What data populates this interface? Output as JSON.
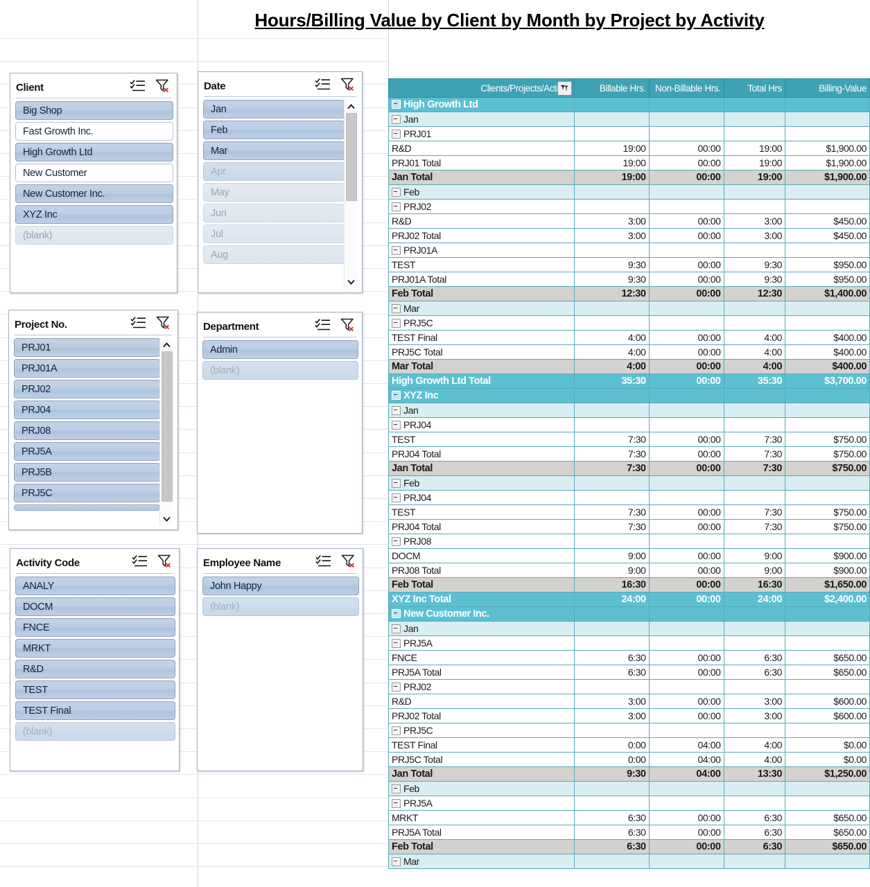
{
  "page": {
    "title": "Hours/Billing Value by Client by Month by Project by Activity"
  },
  "slicers": [
    {
      "name": "client",
      "title": "Client",
      "icons": {
        "multi_select": "multi-select-icon",
        "clear_filter": "clear-filter-icon"
      },
      "has_scrollbar": false,
      "items": [
        {
          "label": "Big Shop",
          "state": "selected"
        },
        {
          "label": "Fast Growth Inc.",
          "state": "unselected"
        },
        {
          "label": "High Growth Ltd",
          "state": "selected"
        },
        {
          "label": "New Customer",
          "state": "unselected"
        },
        {
          "label": "New Customer Inc.",
          "state": "selected"
        },
        {
          "label": "XYZ Inc",
          "state": "selected"
        },
        {
          "label": "(blank)",
          "state": "nodata"
        }
      ]
    },
    {
      "name": "date",
      "title": "Date",
      "icons": {
        "multi_select": "multi-select-icon",
        "clear_filter": "clear-filter-icon"
      },
      "has_scrollbar": true,
      "items": [
        {
          "label": "Jan",
          "state": "selected"
        },
        {
          "label": "Feb",
          "state": "selected"
        },
        {
          "label": "Mar",
          "state": "selected"
        },
        {
          "label": "Apr",
          "state": "nodata-selected"
        },
        {
          "label": "May",
          "state": "nodata"
        },
        {
          "label": "Jun",
          "state": "nodata"
        },
        {
          "label": "Jul",
          "state": "nodata"
        },
        {
          "label": "Aug",
          "state": "nodata"
        }
      ]
    },
    {
      "name": "project-no",
      "title": "Project No.",
      "icons": {
        "multi_select": "multi-select-icon",
        "clear_filter": "clear-filter-icon"
      },
      "has_scrollbar": true,
      "items": [
        {
          "label": "PRJ01",
          "state": "selected"
        },
        {
          "label": "PRJ01A",
          "state": "selected"
        },
        {
          "label": "PRJ02",
          "state": "selected"
        },
        {
          "label": "PRJ04",
          "state": "selected"
        },
        {
          "label": "PRJ08",
          "state": "selected"
        },
        {
          "label": "PRJ5A",
          "state": "selected"
        },
        {
          "label": "PRJ5B",
          "state": "selected"
        },
        {
          "label": "PRJ5C",
          "state": "selected"
        }
      ]
    },
    {
      "name": "department",
      "title": "Department",
      "icons": {
        "multi_select": "multi-select-icon",
        "clear_filter": "clear-filter-icon"
      },
      "has_scrollbar": false,
      "items": [
        {
          "label": "Admin",
          "state": "selected"
        },
        {
          "label": "(blank)",
          "state": "nodata-selected"
        }
      ]
    },
    {
      "name": "activity-code",
      "title": "Activity Code",
      "icons": {
        "multi_select": "multi-select-icon",
        "clear_filter": "clear-filter-icon"
      },
      "has_scrollbar": false,
      "items": [
        {
          "label": "ANALY",
          "state": "selected"
        },
        {
          "label": "DOCM",
          "state": "selected"
        },
        {
          "label": "FNCE",
          "state": "selected"
        },
        {
          "label": "MRKT",
          "state": "selected"
        },
        {
          "label": "R&D",
          "state": "selected"
        },
        {
          "label": "TEST",
          "state": "selected"
        },
        {
          "label": "TEST Final",
          "state": "selected"
        },
        {
          "label": "(blank)",
          "state": "nodata-selected"
        }
      ]
    },
    {
      "name": "employee-name",
      "title": "Employee Name",
      "icons": {
        "multi_select": "multi-select-icon",
        "clear_filter": "clear-filter-icon"
      },
      "has_scrollbar": false,
      "items": [
        {
          "label": "John Happy",
          "state": "selected"
        },
        {
          "label": "(blank)",
          "state": "nodata-selected"
        }
      ]
    }
  ],
  "pivot": {
    "columns": [
      "Clients/Projects/Activity",
      "Billable Hrs.",
      "Non-Billable Hrs.",
      "Total Hrs",
      "Billing-Value"
    ],
    "filter_icon": "filter-dropdown-icon",
    "rows": [
      {
        "level": "client",
        "label": "High Growth Ltd",
        "expand": true,
        "billable": "",
        "nonbillable": "",
        "total": "",
        "value": ""
      },
      {
        "level": "month",
        "label": "Jan",
        "expand": true,
        "billable": "",
        "nonbillable": "",
        "total": "",
        "value": ""
      },
      {
        "level": "project",
        "label": "PRJ01",
        "expand": true,
        "billable": "",
        "nonbillable": "",
        "total": "",
        "value": ""
      },
      {
        "level": "activity",
        "label": "R&D",
        "expand": false,
        "billable": "19:00",
        "nonbillable": "00:00",
        "total": "19:00",
        "value": "$1,900.00"
      },
      {
        "level": "projtotal",
        "label": "PRJ01 Total",
        "expand": false,
        "billable": "19:00",
        "nonbillable": "00:00",
        "total": "19:00",
        "value": "$1,900.00"
      },
      {
        "level": "monthtotal",
        "label": "Jan Total",
        "expand": false,
        "billable": "19:00",
        "nonbillable": "00:00",
        "total": "19:00",
        "value": "$1,900.00"
      },
      {
        "level": "month",
        "label": "Feb",
        "expand": true,
        "billable": "",
        "nonbillable": "",
        "total": "",
        "value": ""
      },
      {
        "level": "project",
        "label": "PRJ02",
        "expand": true,
        "billable": "",
        "nonbillable": "",
        "total": "",
        "value": ""
      },
      {
        "level": "activity",
        "label": "R&D",
        "expand": false,
        "billable": "3:00",
        "nonbillable": "00:00",
        "total": "3:00",
        "value": "$450.00"
      },
      {
        "level": "projtotal",
        "label": "PRJ02 Total",
        "expand": false,
        "billable": "3:00",
        "nonbillable": "00:00",
        "total": "3:00",
        "value": "$450.00"
      },
      {
        "level": "project",
        "label": "PRJ01A",
        "expand": true,
        "billable": "",
        "nonbillable": "",
        "total": "",
        "value": ""
      },
      {
        "level": "activity",
        "label": "TEST",
        "expand": false,
        "billable": "9:30",
        "nonbillable": "00:00",
        "total": "9:30",
        "value": "$950.00"
      },
      {
        "level": "projtotal",
        "label": "PRJ01A Total",
        "expand": false,
        "billable": "9:30",
        "nonbillable": "00:00",
        "total": "9:30",
        "value": "$950.00"
      },
      {
        "level": "monthtotal",
        "label": "Feb Total",
        "expand": false,
        "billable": "12:30",
        "nonbillable": "00:00",
        "total": "12:30",
        "value": "$1,400.00"
      },
      {
        "level": "month",
        "label": "Mar",
        "expand": true,
        "billable": "",
        "nonbillable": "",
        "total": "",
        "value": ""
      },
      {
        "level": "project",
        "label": "PRJ5C",
        "expand": true,
        "billable": "",
        "nonbillable": "",
        "total": "",
        "value": ""
      },
      {
        "level": "activity",
        "label": "TEST Final",
        "expand": false,
        "billable": "4:00",
        "nonbillable": "00:00",
        "total": "4:00",
        "value": "$400.00"
      },
      {
        "level": "projtotal",
        "label": "PRJ5C Total",
        "expand": false,
        "billable": "4:00",
        "nonbillable": "00:00",
        "total": "4:00",
        "value": "$400.00"
      },
      {
        "level": "monthtotal",
        "label": "Mar Total",
        "expand": false,
        "billable": "4:00",
        "nonbillable": "00:00",
        "total": "4:00",
        "value": "$400.00"
      },
      {
        "level": "clienttotal",
        "label": "High Growth Ltd Total",
        "expand": false,
        "billable": "35:30",
        "nonbillable": "00:00",
        "total": "35:30",
        "value": "$3,700.00"
      },
      {
        "level": "client",
        "label": "XYZ Inc",
        "expand": true,
        "billable": "",
        "nonbillable": "",
        "total": "",
        "value": ""
      },
      {
        "level": "month",
        "label": "Jan",
        "expand": true,
        "billable": "",
        "nonbillable": "",
        "total": "",
        "value": ""
      },
      {
        "level": "project",
        "label": "PRJ04",
        "expand": true,
        "billable": "",
        "nonbillable": "",
        "total": "",
        "value": ""
      },
      {
        "level": "activity",
        "label": "TEST",
        "expand": false,
        "billable": "7:30",
        "nonbillable": "00:00",
        "total": "7:30",
        "value": "$750.00"
      },
      {
        "level": "projtotal",
        "label": "PRJ04 Total",
        "expand": false,
        "billable": "7:30",
        "nonbillable": "00:00",
        "total": "7:30",
        "value": "$750.00"
      },
      {
        "level": "monthtotal",
        "label": "Jan Total",
        "expand": false,
        "billable": "7:30",
        "nonbillable": "00:00",
        "total": "7:30",
        "value": "$750.00"
      },
      {
        "level": "month",
        "label": "Feb",
        "expand": true,
        "billable": "",
        "nonbillable": "",
        "total": "",
        "value": ""
      },
      {
        "level": "project",
        "label": "PRJ04",
        "expand": true,
        "billable": "",
        "nonbillable": "",
        "total": "",
        "value": ""
      },
      {
        "level": "activity",
        "label": "TEST",
        "expand": false,
        "billable": "7:30",
        "nonbillable": "00:00",
        "total": "7:30",
        "value": "$750.00"
      },
      {
        "level": "projtotal",
        "label": "PRJ04 Total",
        "expand": false,
        "billable": "7:30",
        "nonbillable": "00:00",
        "total": "7:30",
        "value": "$750.00"
      },
      {
        "level": "project",
        "label": "PRJ08",
        "expand": true,
        "billable": "",
        "nonbillable": "",
        "total": "",
        "value": ""
      },
      {
        "level": "activity",
        "label": "DOCM",
        "expand": false,
        "billable": "9:00",
        "nonbillable": "00:00",
        "total": "9:00",
        "value": "$900.00"
      },
      {
        "level": "projtotal",
        "label": "PRJ08 Total",
        "expand": false,
        "billable": "9:00",
        "nonbillable": "00:00",
        "total": "9:00",
        "value": "$900.00"
      },
      {
        "level": "monthtotal",
        "label": "Feb Total",
        "expand": false,
        "billable": "16:30",
        "nonbillable": "00:00",
        "total": "16:30",
        "value": "$1,650.00"
      },
      {
        "level": "clienttotal",
        "label": "XYZ Inc Total",
        "expand": false,
        "billable": "24:00",
        "nonbillable": "00:00",
        "total": "24:00",
        "value": "$2,400.00"
      },
      {
        "level": "client",
        "label": "New Customer Inc.",
        "expand": true,
        "billable": "",
        "nonbillable": "",
        "total": "",
        "value": ""
      },
      {
        "level": "month",
        "label": "Jan",
        "expand": true,
        "billable": "",
        "nonbillable": "",
        "total": "",
        "value": ""
      },
      {
        "level": "project",
        "label": "PRJ5A",
        "expand": true,
        "billable": "",
        "nonbillable": "",
        "total": "",
        "value": ""
      },
      {
        "level": "activity",
        "label": "FNCE",
        "expand": false,
        "billable": "6:30",
        "nonbillable": "00:00",
        "total": "6:30",
        "value": "$650.00"
      },
      {
        "level": "projtotal",
        "label": "PRJ5A Total",
        "expand": false,
        "billable": "6:30",
        "nonbillable": "00:00",
        "total": "6:30",
        "value": "$650.00"
      },
      {
        "level": "project",
        "label": "PRJ02",
        "expand": true,
        "billable": "",
        "nonbillable": "",
        "total": "",
        "value": ""
      },
      {
        "level": "activity",
        "label": "R&D",
        "expand": false,
        "billable": "3:00",
        "nonbillable": "00:00",
        "total": "3:00",
        "value": "$600.00"
      },
      {
        "level": "projtotal",
        "label": "PRJ02 Total",
        "expand": false,
        "billable": "3:00",
        "nonbillable": "00:00",
        "total": "3:00",
        "value": "$600.00"
      },
      {
        "level": "project",
        "label": "PRJ5C",
        "expand": true,
        "billable": "",
        "nonbillable": "",
        "total": "",
        "value": ""
      },
      {
        "level": "activity",
        "label": "TEST Final",
        "expand": false,
        "billable": "0:00",
        "nonbillable": "04:00",
        "total": "4:00",
        "value": "$0.00"
      },
      {
        "level": "projtotal",
        "label": "PRJ5C Total",
        "expand": false,
        "billable": "0:00",
        "nonbillable": "04:00",
        "total": "4:00",
        "value": "$0.00"
      },
      {
        "level": "monthtotal",
        "label": "Jan Total",
        "expand": false,
        "billable": "9:30",
        "nonbillable": "04:00",
        "total": "13:30",
        "value": "$1,250.00"
      },
      {
        "level": "month",
        "label": "Feb",
        "expand": true,
        "billable": "",
        "nonbillable": "",
        "total": "",
        "value": ""
      },
      {
        "level": "project",
        "label": "PRJ5A",
        "expand": true,
        "billable": "",
        "nonbillable": "",
        "total": "",
        "value": ""
      },
      {
        "level": "activity",
        "label": "MRKT",
        "expand": false,
        "billable": "6:30",
        "nonbillable": "00:00",
        "total": "6:30",
        "value": "$650.00"
      },
      {
        "level": "projtotal",
        "label": "PRJ5A Total",
        "expand": false,
        "billable": "6:30",
        "nonbillable": "00:00",
        "total": "6:30",
        "value": "$650.00"
      },
      {
        "level": "monthtotal",
        "label": "Feb Total",
        "expand": false,
        "billable": "6:30",
        "nonbillable": "00:00",
        "total": "6:30",
        "value": "$650.00"
      },
      {
        "level": "month",
        "label": "Mar",
        "expand": true,
        "billable": "",
        "nonbillable": "",
        "total": "",
        "value": ""
      }
    ]
  },
  "colors": {
    "header_teal": "#3fa3b5",
    "client_row_teal": "#5cc0d2",
    "month_row": "#d9eef3",
    "month_total_gray": "#d4d2cf",
    "slicer_selected": "#bccee4"
  }
}
